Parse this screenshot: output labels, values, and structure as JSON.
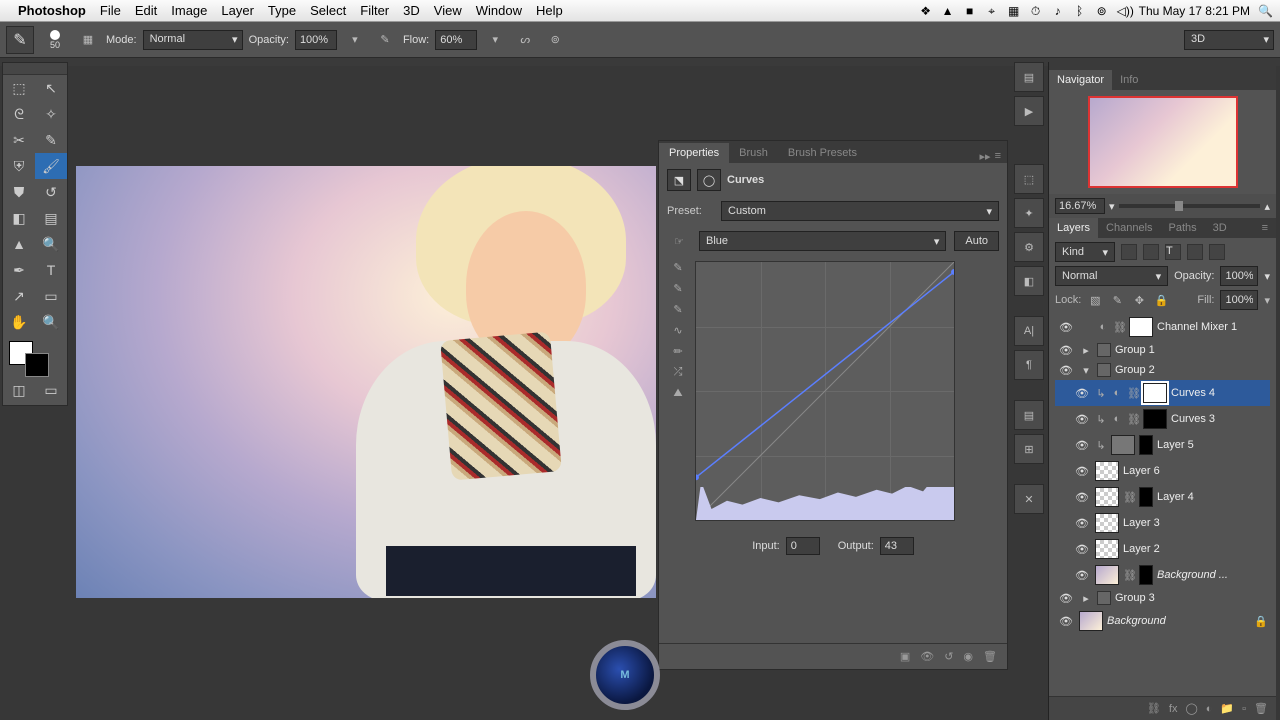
{
  "menubar": {
    "app_name": "Photoshop",
    "items": [
      "File",
      "Edit",
      "Image",
      "Layer",
      "Type",
      "Select",
      "Filter",
      "3D",
      "View",
      "Window",
      "Help"
    ],
    "clock": "Thu May 17  8:21 PM",
    "status_icons": [
      "❖",
      "▲",
      "■",
      "☁",
      "▦",
      "⏱",
      "♪",
      "☰",
      "⇪",
      "⊚",
      "◍"
    ]
  },
  "options": {
    "brush_size": "50",
    "mode_label": "Mode:",
    "mode_value": "Normal",
    "opacity_label": "Opacity:",
    "opacity_value": "100%",
    "flow_label": "Flow:",
    "flow_value": "60%",
    "workspace": "3D"
  },
  "props": {
    "tabs": [
      "Properties",
      "Brush",
      "Brush Presets"
    ],
    "title": "Curves",
    "preset_label": "Preset:",
    "preset_value": "Custom",
    "channel_value": "Blue",
    "auto_label": "Auto",
    "input_label": "Input:",
    "input_value": "0",
    "output_label": "Output:",
    "output_value": "43"
  },
  "navigator": {
    "tabs": [
      "Navigator",
      "Info"
    ],
    "zoom": "16.67%"
  },
  "layers": {
    "tabs": [
      "Layers",
      "Channels",
      "Paths",
      "3D"
    ],
    "kind_label": "Kind",
    "blend_mode": "Normal",
    "opacity_label": "Opacity:",
    "opacity_value": "100%",
    "lock_label": "Lock:",
    "fill_label": "Fill:",
    "fill_value": "100%",
    "items": [
      {
        "name": "Channel Mixer 1",
        "type": "adj"
      },
      {
        "name": "Group 1",
        "type": "group"
      },
      {
        "name": "Group 2",
        "type": "group_open"
      },
      {
        "name": "Curves 4",
        "type": "adj",
        "selected": true
      },
      {
        "name": "Curves 3",
        "type": "adj_mask"
      },
      {
        "name": "Layer 5",
        "type": "gray"
      },
      {
        "name": "Layer 6",
        "type": "chk"
      },
      {
        "name": "Layer 4",
        "type": "chk_mask"
      },
      {
        "name": "Layer 3",
        "type": "chk"
      },
      {
        "name": "Layer 2",
        "type": "chk"
      },
      {
        "name": "Background ...",
        "type": "img_mask"
      },
      {
        "name": "Group 3",
        "type": "group"
      },
      {
        "name": "Background",
        "type": "img",
        "locked": true
      }
    ]
  },
  "logo": "M"
}
